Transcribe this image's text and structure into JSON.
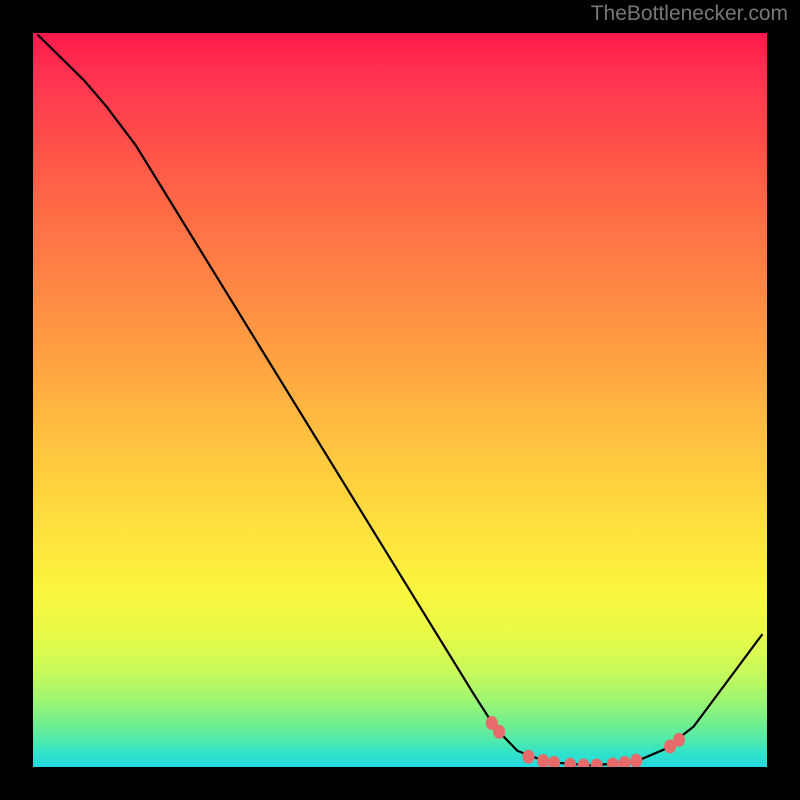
{
  "attribution": "TheBottlenecker.com",
  "chart_data": {
    "type": "line",
    "title": "",
    "xlabel": "",
    "ylabel": "",
    "xlim": [
      0,
      100
    ],
    "ylim": [
      0,
      100
    ],
    "curve_points": [
      {
        "x": 0.7,
        "y": 99.7
      },
      {
        "x": 7.0,
        "y": 93.5
      },
      {
        "x": 10.0,
        "y": 90.0
      },
      {
        "x": 14.0,
        "y": 84.7
      },
      {
        "x": 60.0,
        "y": 10.0
      },
      {
        "x": 63.0,
        "y": 5.3
      },
      {
        "x": 66.0,
        "y": 2.2
      },
      {
        "x": 70.0,
        "y": 0.7
      },
      {
        "x": 76.0,
        "y": 0.2
      },
      {
        "x": 82.0,
        "y": 0.7
      },
      {
        "x": 86.0,
        "y": 2.4
      },
      {
        "x": 90.0,
        "y": 5.5
      },
      {
        "x": 99.3,
        "y": 18.0
      }
    ],
    "marker_points": [
      {
        "x": 62.5,
        "y": 6.0
      },
      {
        "x": 63.5,
        "y": 4.8
      },
      {
        "x": 67.5,
        "y": 1.4
      },
      {
        "x": 69.5,
        "y": 0.8
      },
      {
        "x": 71.0,
        "y": 0.55
      },
      {
        "x": 73.2,
        "y": 0.3
      },
      {
        "x": 75.0,
        "y": 0.2
      },
      {
        "x": 76.8,
        "y": 0.2
      },
      {
        "x": 79.0,
        "y": 0.35
      },
      {
        "x": 80.6,
        "y": 0.55
      },
      {
        "x": 82.2,
        "y": 0.85
      },
      {
        "x": 86.8,
        "y": 2.8
      },
      {
        "x": 88.0,
        "y": 3.7
      }
    ],
    "marker_color": "#e86b6b",
    "curve_color": "#000000"
  }
}
